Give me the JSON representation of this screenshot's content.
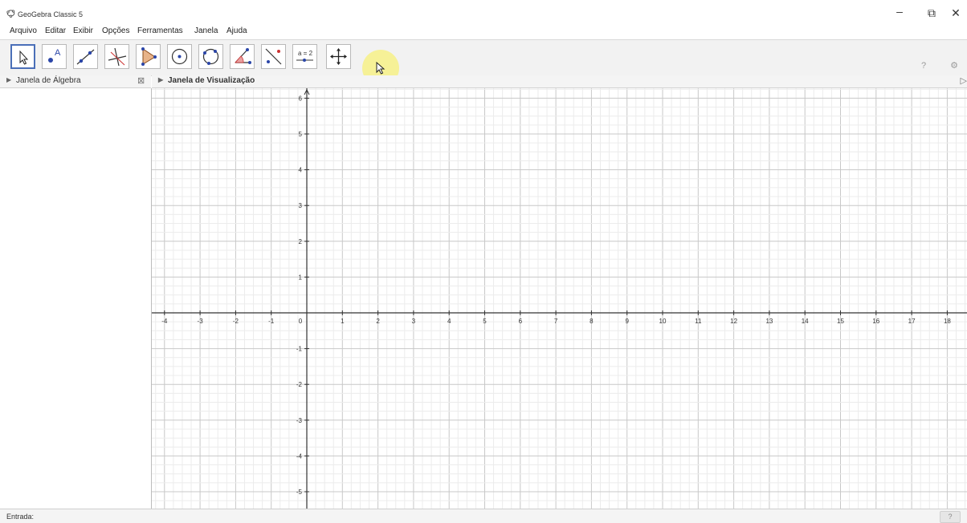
{
  "window": {
    "title": "GeoGebra Classic 5",
    "minimize_icon": "minimize-icon",
    "restore_icon": "restore-icon",
    "close_icon": "close-icon"
  },
  "menu": [
    "Arquivo",
    "Editar",
    "Exibir",
    "Opções",
    "Ferramentas",
    "Janela",
    "Ajuda"
  ],
  "toolbar": {
    "tools": [
      {
        "icon": "move-icon",
        "selected": true
      },
      {
        "icon": "point-icon",
        "label": "A"
      },
      {
        "icon": "line-icon"
      },
      {
        "icon": "perpendicular-line-icon"
      },
      {
        "icon": "polygon-icon"
      },
      {
        "icon": "circle-center-point-icon"
      },
      {
        "icon": "circle-three-points-icon"
      },
      {
        "icon": "angle-icon"
      },
      {
        "icon": "reflect-point-icon"
      },
      {
        "icon": "slider-icon",
        "label": "a = 2"
      },
      {
        "icon": "move-graphics-view-icon"
      }
    ],
    "undo_icon": "undo-icon",
    "redo_icon": "redo-icon",
    "help_icon": "help-icon",
    "settings_icon": "settings-icon"
  },
  "algebra_panel": {
    "title": "Janela de Álgebra"
  },
  "graphics_panel": {
    "title": "Janela de Visualização"
  },
  "axes": {
    "x_ticks": [
      "-4",
      "-3",
      "-2",
      "-1",
      "0",
      "1",
      "2",
      "3",
      "4",
      "5",
      "6",
      "7",
      "8",
      "9",
      "10",
      "11",
      "12",
      "13",
      "14",
      "15",
      "16",
      "17",
      "18"
    ],
    "y_ticks_pos": [
      "6",
      "5",
      "4",
      "3",
      "2",
      "1"
    ],
    "y_ticks_neg": [
      "-1",
      "-2",
      "-3",
      "-4",
      "-5"
    ]
  },
  "input_bar": {
    "label": "Entrada:",
    "value": "",
    "help_label": "?"
  }
}
